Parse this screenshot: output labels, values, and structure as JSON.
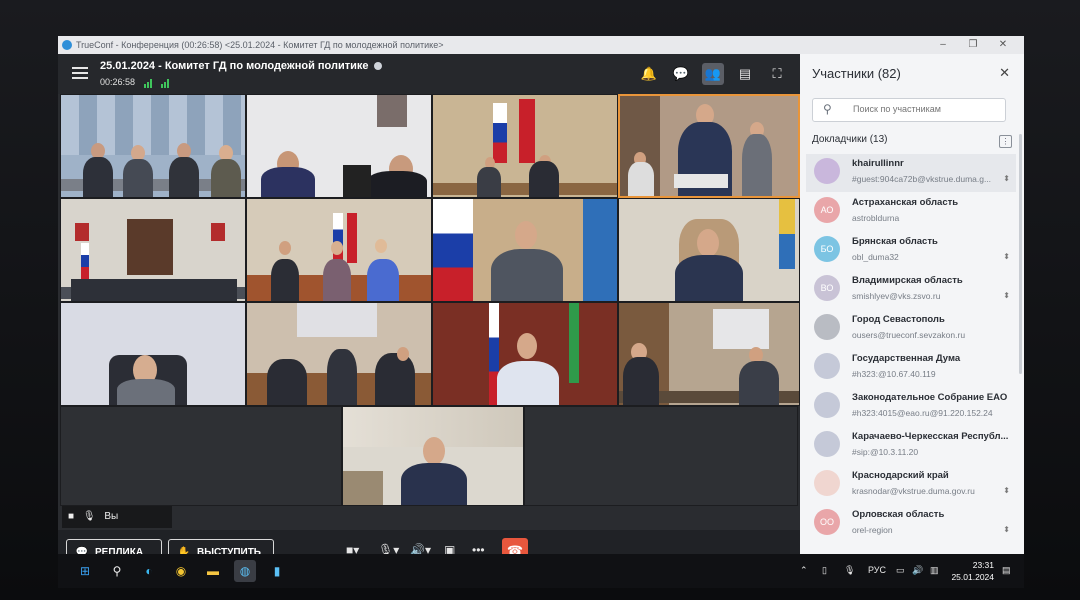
{
  "window": {
    "title": "TrueConf - Конференция (00:26:58) <25.01.2024 - Комитет ГД по молодежной политике>",
    "minimize": "–",
    "maximize": "❐",
    "close": "✕"
  },
  "conference": {
    "title": "25.01.2024 - Комитет ГД по молодежной политике",
    "timer": "00:26:58"
  },
  "self_label": "Вы",
  "controls": {
    "replica_label": "РЕПЛИКА",
    "speak_label": "ВЫСТУПИТЬ",
    "more": "•••"
  },
  "participants": {
    "header": "Участники (82)",
    "search_placeholder": "Поиск по участникам",
    "section_label": "Докладчики (13)",
    "items": [
      {
        "name": "khairullinnr",
        "detail": "#guest:904ca72b@vkstrue.duma.g...",
        "avatar": "",
        "color": "#c9b7dc"
      },
      {
        "name": "Астраханская область",
        "detail": "astrobldurna",
        "avatar": "АО",
        "color": "#e9a6a9"
      },
      {
        "name": "Брянская область",
        "detail": "obl_duma32",
        "avatar": "БО",
        "color": "#7cc4e3"
      },
      {
        "name": "Владимирская область",
        "detail": "smishlyev@vks.zsvo.ru",
        "avatar": "ВО",
        "color": "#c9c3d6"
      },
      {
        "name": "Город Севастополь",
        "detail": "ousers@trueconf.sevzakon.ru",
        "avatar": "",
        "color": "#b9bcc3"
      },
      {
        "name": "Государственная Дума",
        "detail": "#h323:@10.67.40.119",
        "avatar": "",
        "color": "#c5c9d8"
      },
      {
        "name": "Законодательное Собрание ЕАО",
        "detail": "#h323:4015@eao.ru@91.220.152.24",
        "avatar": "",
        "color": "#c5c9d8"
      },
      {
        "name": "Карачаево-Черкесская Республ...",
        "detail": "#sip:@10.3.11.20",
        "avatar": "",
        "color": "#c5c9d8"
      },
      {
        "name": "Краснодарский край",
        "detail": "krasnodar@vkstrue.duma.gov.ru",
        "avatar": "",
        "color": "#f0d6d0"
      },
      {
        "name": "Орловская область",
        "detail": "orel-region",
        "avatar": "ОО",
        "color": "#e9a6a9"
      }
    ]
  },
  "taskbar": {
    "lang": "РУС",
    "time": "23:31",
    "date": "25.01.2024"
  },
  "colors": {
    "accent": "#e9953a",
    "hangup": "#e8573d",
    "signal": "#3fc55c"
  }
}
